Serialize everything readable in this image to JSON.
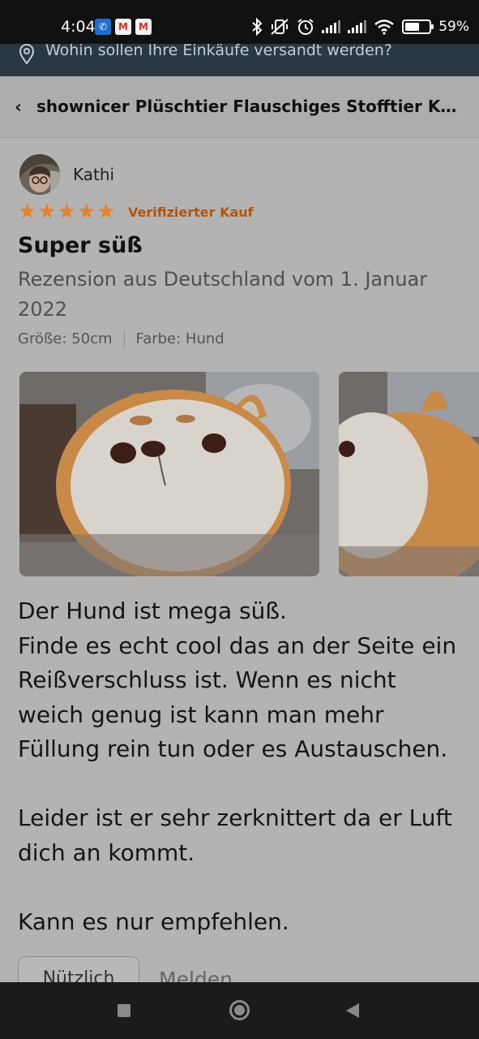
{
  "status_bar": {
    "time": "4:04",
    "notifications": [
      {
        "icon": "app-notification-icon",
        "color": "#1c6fd6"
      },
      {
        "icon": "gmail-icon",
        "color": "#f2f2f2"
      },
      {
        "icon": "gmail-icon",
        "color": "#f2f2f2"
      }
    ],
    "battery_level": 0.59,
    "battery_percent": "59%"
  },
  "delivery": {
    "text": "Wohin sollen Ihre Einkäufe versandt werden?"
  },
  "header": {
    "back_glyph": "‹",
    "title": "shownicer Plüschtier Flauschiges Stofftier Kawaii"
  },
  "review": {
    "reviewer_name": "Kathi",
    "rating": 5,
    "verified_label": "Verifizierter Kauf",
    "title": "Super süß",
    "meta": "Rezension aus Deutschland vom 1. Januar 2022",
    "size": "Größe: 50cm",
    "color": "Farbe: Hund",
    "body": "Der Hund ist mega süß.\nFinde es echt cool das an der Seite ein Reißverschluss ist. Wenn es nicht weich genug ist kann man mehr Füllung rein tun oder es Austauschen.\n\nLeider ist er sehr zerknittert da er Luft dich an kommt.\n\nKann es nur empfehlen.",
    "helpful_label": "Nützlich",
    "report_label": "Melden"
  },
  "colors": {
    "star": "#e3832f",
    "verified": "#b2560e",
    "page_background": "#b3b3b3"
  }
}
